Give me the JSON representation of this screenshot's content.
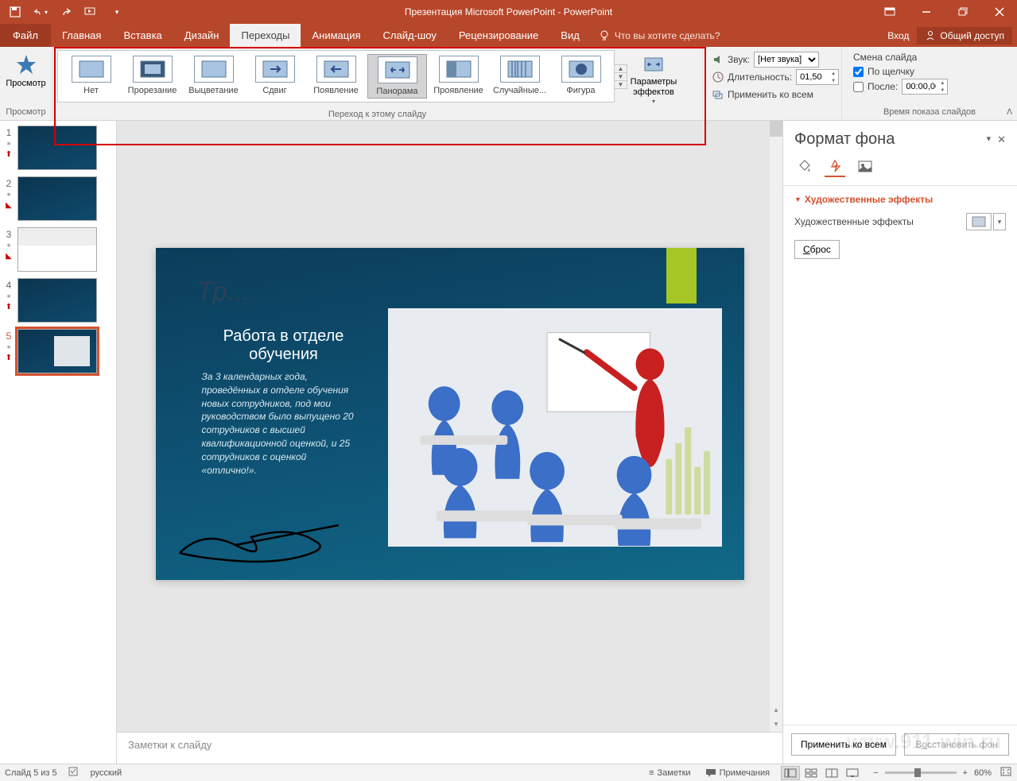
{
  "window": {
    "title": "Презентация Microsoft PowerPoint - PowerPoint"
  },
  "tabs": {
    "file": "Файл",
    "home": "Главная",
    "insert": "Вставка",
    "design": "Дизайн",
    "transitions": "Переходы",
    "animations": "Анимация",
    "slideshow": "Слайд-шоу",
    "review": "Рецензирование",
    "view": "Вид",
    "tellme": "Что вы хотите сделать?",
    "signin": "Вход",
    "share": "Общий доступ"
  },
  "ribbon": {
    "preview": {
      "label": "Просмотр",
      "group": "Просмотр"
    },
    "transitions_group": "Переход к этому слайду",
    "gallery": [
      {
        "label": "Нет"
      },
      {
        "label": "Прорезание"
      },
      {
        "label": "Выцветание"
      },
      {
        "label": "Сдвиг"
      },
      {
        "label": "Появление"
      },
      {
        "label": "Панорама"
      },
      {
        "label": "Проявление"
      },
      {
        "label": "Случайные..."
      },
      {
        "label": "Фигура"
      }
    ],
    "effect_options": "Параметры эффектов",
    "timing": {
      "sound": "Звук:",
      "sound_value": "[Нет звука]",
      "duration": "Длительность:",
      "duration_value": "01,50",
      "apply_all": "Применить ко всем"
    },
    "advance": {
      "title": "Смена слайда",
      "on_click": "По щелчку",
      "after": "После:",
      "after_value": "00:00,00",
      "group": "Время показа слайдов"
    }
  },
  "slides": [
    {
      "num": "1"
    },
    {
      "num": "2"
    },
    {
      "num": "3"
    },
    {
      "num": "4"
    },
    {
      "num": "5"
    }
  ],
  "slide_content": {
    "faded_title": "Тр...",
    "heading": "Работа в отделе обучения",
    "body": "За 3 календарных года, проведённых в отделе обучения новых сотрудников, под мои руководством было выпущено 20 сотрудников с высшей квалификационной оценкой, и 25 сотрудников с оценкой «отлично!»."
  },
  "notes": {
    "placeholder": "Заметки к слайду"
  },
  "format_pane": {
    "title": "Формат фона",
    "section": "Художественные эффекты",
    "effects_label": "Художественные эффекты",
    "reset": "Сброс",
    "apply_all": "Применить ко всем",
    "restore": "Восстановить фон"
  },
  "statusbar": {
    "slide_count": "Слайд 5 из 5",
    "lang": "русский",
    "notes": "Заметки",
    "comments": "Примечания",
    "zoom": "60%"
  },
  "watermark": "www.911-win.ru"
}
